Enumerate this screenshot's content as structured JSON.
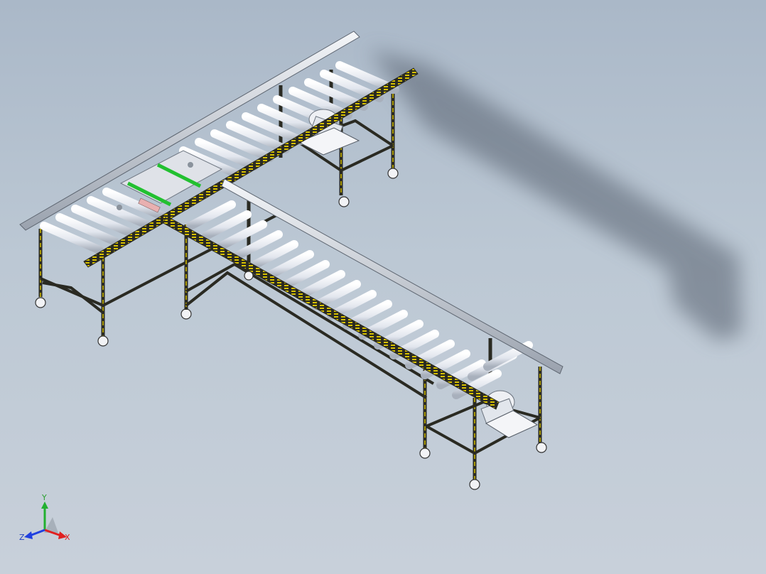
{
  "triad": {
    "x_label": "X",
    "y_label": "Y",
    "z_label": "Z"
  },
  "colors": {
    "background_top": "#aab8c8",
    "background_bottom": "#c8d0da",
    "frame_yellow": "#c8b400",
    "frame_dark": "#2a2a22",
    "roller": "#eef0f4",
    "rail": "#d8dce4",
    "guide_green": "#22c030",
    "shadow": "#55606c"
  },
  "icons": {
    "triad": "coordinate-triad-icon"
  }
}
